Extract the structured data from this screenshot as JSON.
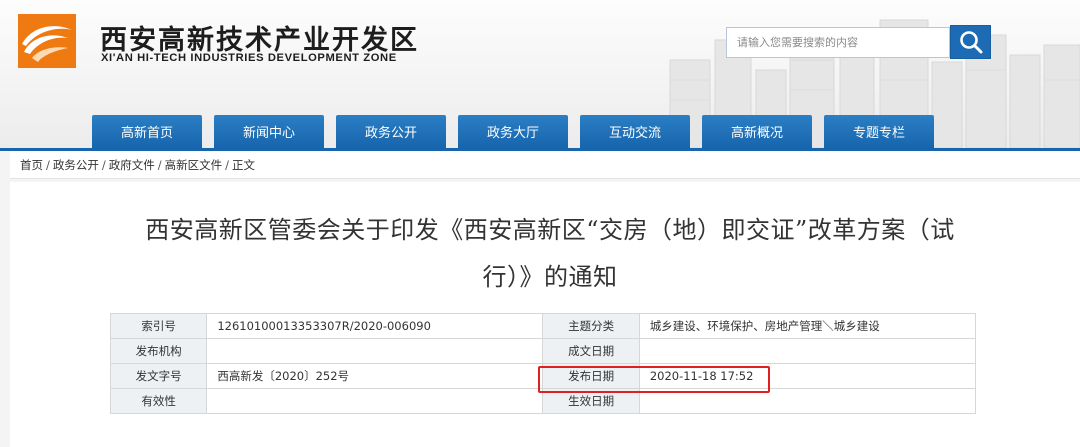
{
  "site": {
    "title": "西安高新技术产业开发区",
    "subtitle": "XI'AN HI-TECH INDUSTRIES DEVELOPMENT ZONE"
  },
  "search": {
    "placeholder": "请输入您需要搜索的内容",
    "icon": "search-icon"
  },
  "nav": {
    "items": [
      "高新首页",
      "新闻中心",
      "政务公开",
      "政务大厅",
      "互动交流",
      "高新概况",
      "专题专栏"
    ]
  },
  "breadcrumb": {
    "items": [
      "首页",
      "政务公开",
      "政府文件",
      "高新区文件",
      "正文"
    ]
  },
  "article": {
    "title_line1": "西安高新区管委会关于印发《西安高新区“交房（地）即交证”改革方案（试",
    "title_line2": "行）》的通知"
  },
  "meta": {
    "rows": [
      {
        "label1": "索引号",
        "value1": "12610100013353307R/2020-006090",
        "label2": "主题分类",
        "value2": "城乡建设、环境保护、房地产管理＼城乡建设"
      },
      {
        "label1": "发布机构",
        "value1": "",
        "label2": "成文日期",
        "value2": ""
      },
      {
        "label1": "发文字号",
        "value1": "西高新发〔2020〕252号",
        "label2": "发布日期",
        "value2": "2020-11-18 17:52"
      },
      {
        "label1": "有效性",
        "value1": "",
        "label2": "生效日期",
        "value2": ""
      }
    ]
  },
  "colors": {
    "nav_blue": "#1765ad",
    "highlight_red": "#e02020",
    "logo_orange": "#f07a12"
  }
}
